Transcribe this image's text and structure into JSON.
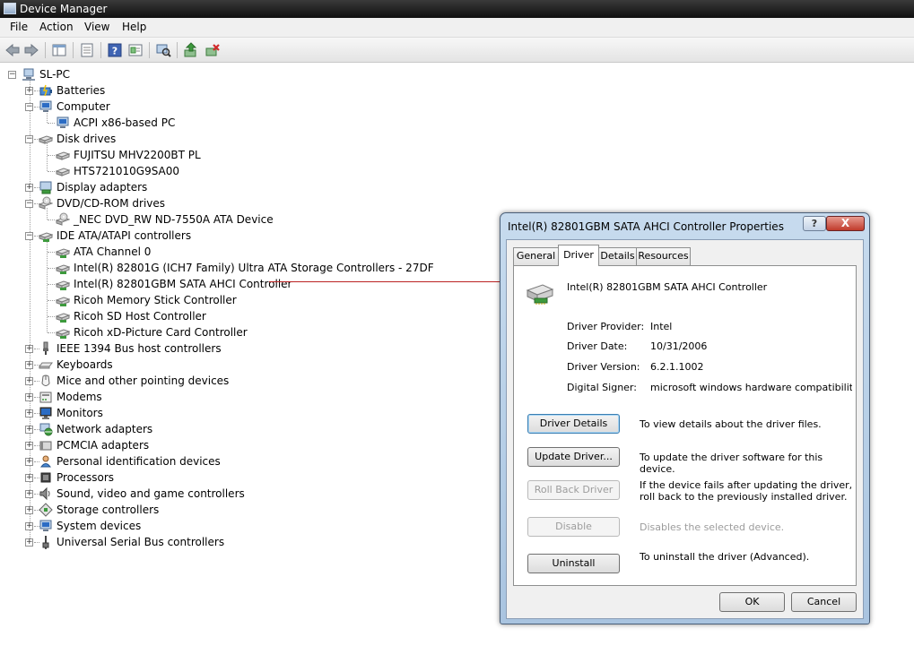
{
  "window": {
    "title": "Device Manager"
  },
  "menu": [
    "File",
    "Action",
    "View",
    "Help"
  ],
  "toolbar": [
    {
      "icon": "back-arrow-icon"
    },
    {
      "icon": "forward-arrow-icon"
    },
    {
      "icon": "show-hide-tree-icon"
    },
    {
      "icon": "properties-icon"
    },
    {
      "icon": "help-icon"
    },
    {
      "icon": "view-icon"
    },
    {
      "icon": "scan-hardware-icon"
    },
    {
      "icon": "update-driver-icon"
    },
    {
      "icon": "uninstall-icon"
    }
  ],
  "tree": [
    {
      "label": "SL-PC",
      "level": 0,
      "icon": "computer-network-icon",
      "state": "open"
    },
    {
      "label": "Batteries",
      "level": 1,
      "icon": "battery-icon",
      "state": "closed"
    },
    {
      "label": "Computer",
      "level": 1,
      "icon": "computer-icon",
      "state": "open"
    },
    {
      "label": "ACPI x86-based PC",
      "level": 2,
      "icon": "computer-icon",
      "state": "leaf"
    },
    {
      "label": "Disk drives",
      "level": 1,
      "icon": "disk-drive-icon",
      "state": "open"
    },
    {
      "label": "FUJITSU MHV2200BT PL",
      "level": 2,
      "icon": "disk-drive-icon",
      "state": "leaf"
    },
    {
      "label": "HTS721010G9SA00",
      "level": 2,
      "icon": "disk-drive-icon",
      "state": "leaf"
    },
    {
      "label": "Display adapters",
      "level": 1,
      "icon": "display-adapter-icon",
      "state": "closed"
    },
    {
      "label": "DVD/CD-ROM drives",
      "level": 1,
      "icon": "dvd-drive-icon",
      "state": "open"
    },
    {
      "label": "_NEC DVD_RW ND-7550A ATA Device",
      "level": 2,
      "icon": "dvd-drive-icon",
      "state": "leaf"
    },
    {
      "label": "IDE ATA/ATAPI controllers",
      "level": 1,
      "icon": "controller-icon",
      "state": "open"
    },
    {
      "label": "ATA Channel 0",
      "level": 2,
      "icon": "controller-icon",
      "state": "leaf"
    },
    {
      "label": "Intel(R) 82801G (ICH7 Family) Ultra ATA Storage Controllers - 27DF",
      "level": 2,
      "icon": "controller-icon",
      "state": "leaf"
    },
    {
      "label": "Intel(R) 82801GBM SATA AHCI Controller",
      "level": 2,
      "icon": "controller-icon",
      "state": "leaf"
    },
    {
      "label": "Ricoh Memory Stick Controller",
      "level": 2,
      "icon": "controller-icon",
      "state": "leaf"
    },
    {
      "label": "Ricoh SD Host Controller",
      "level": 2,
      "icon": "controller-icon",
      "state": "leaf"
    },
    {
      "label": "Ricoh xD-Picture Card Controller",
      "level": 2,
      "icon": "controller-icon",
      "state": "leaf"
    },
    {
      "label": "IEEE 1394 Bus host controllers",
      "level": 1,
      "icon": "ieee1394-icon",
      "state": "closed"
    },
    {
      "label": "Keyboards",
      "level": 1,
      "icon": "keyboard-icon",
      "state": "closed"
    },
    {
      "label": "Mice and other pointing devices",
      "level": 1,
      "icon": "mouse-icon",
      "state": "closed"
    },
    {
      "label": "Modems",
      "level": 1,
      "icon": "modem-icon",
      "state": "closed"
    },
    {
      "label": "Monitors",
      "level": 1,
      "icon": "monitor-icon",
      "state": "closed"
    },
    {
      "label": "Network adapters",
      "level": 1,
      "icon": "network-adapter-icon",
      "state": "closed"
    },
    {
      "label": "PCMCIA adapters",
      "level": 1,
      "icon": "pcmcia-icon",
      "state": "closed"
    },
    {
      "label": "Personal identification devices",
      "level": 1,
      "icon": "identification-icon",
      "state": "closed"
    },
    {
      "label": "Processors",
      "level": 1,
      "icon": "processor-icon",
      "state": "closed"
    },
    {
      "label": "Sound, video and game controllers",
      "level": 1,
      "icon": "sound-icon",
      "state": "closed"
    },
    {
      "label": "Storage controllers",
      "level": 1,
      "icon": "storage-controller-icon",
      "state": "closed"
    },
    {
      "label": "System devices",
      "level": 1,
      "icon": "system-device-icon",
      "state": "closed"
    },
    {
      "label": "Universal Serial Bus controllers",
      "level": 1,
      "icon": "usb-icon",
      "state": "closed"
    }
  ],
  "dialog": {
    "title": "Intel(R) 82801GBM SATA AHCI Controller Properties",
    "help_label": "?",
    "close_label": "X",
    "tabs": [
      "General",
      "Driver",
      "Details",
      "Resources"
    ],
    "active_tab": "Driver",
    "device_name": "Intel(R) 82801GBM SATA AHCI Controller",
    "device_icon": "controller-icon",
    "props": [
      {
        "label": "Driver Provider:",
        "value": "Intel"
      },
      {
        "label": "Driver Date:",
        "value": "10/31/2006"
      },
      {
        "label": "Driver Version:",
        "value": "6.2.1.1002"
      },
      {
        "label": "Digital Signer:",
        "value": "microsoft windows hardware compatibility publisl"
      }
    ],
    "actions": [
      {
        "button": "Driver Details",
        "desc": "To view details about the driver files.",
        "enabled": true
      },
      {
        "button": "Update Driver...",
        "desc": "To update the driver software for this device.",
        "enabled": true
      },
      {
        "button": "Roll Back Driver",
        "desc": "If the device fails after updating the driver, roll back to the previously installed driver.",
        "enabled": false
      },
      {
        "button": "Disable",
        "desc": "Disables the selected device.",
        "enabled": false
      },
      {
        "button": "Uninstall",
        "desc": "To uninstall the driver (Advanced).",
        "enabled": true
      }
    ],
    "ok_label": "OK",
    "cancel_label": "Cancel"
  },
  "colors": {
    "title_bar": "#101010",
    "dialog_frame": "#a9c4e0",
    "callout_line": "#b22222"
  }
}
